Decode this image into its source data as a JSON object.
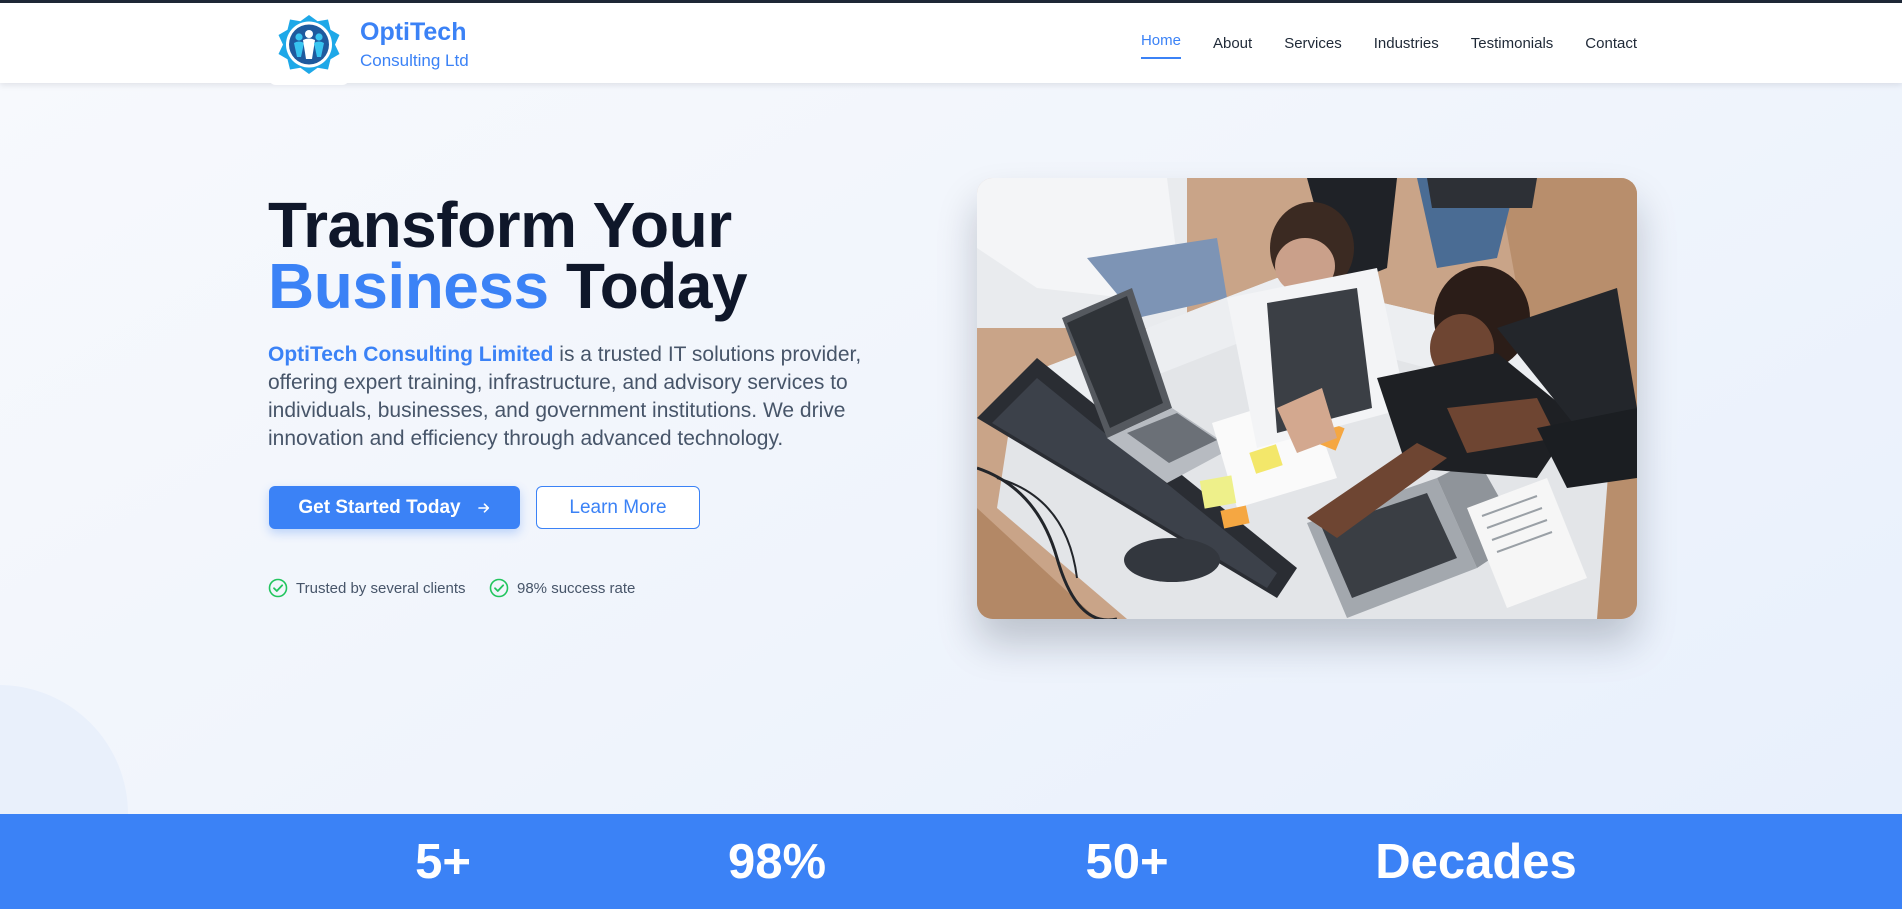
{
  "brand": {
    "name": "OptiTech",
    "subtitle": "Consulting Ltd"
  },
  "nav": {
    "items": [
      {
        "label": "Home",
        "active": true
      },
      {
        "label": "About"
      },
      {
        "label": "Services"
      },
      {
        "label": "Industries"
      },
      {
        "label": "Testimonials"
      },
      {
        "label": "Contact"
      }
    ]
  },
  "hero": {
    "headline_line1": "Transform Your",
    "headline_accent": "Business",
    "headline_rest": " Today",
    "lead_strong": "OptiTech Consulting Limited",
    "lead_rest": " is a trusted IT solutions provider, offering expert training, infrastructure, and advisory services to individuals, businesses, and government institutions. We drive innovation and efficiency through advanced technology.",
    "primary_button": "Get Started Today",
    "primary_button_icon": "arrow-right-icon",
    "secondary_button": "Learn More",
    "trust_items": [
      {
        "label": "Trusted by several clients",
        "icon": "check-circle-icon"
      },
      {
        "label": "98% success rate",
        "icon": "check-circle-icon"
      }
    ],
    "image_icon": "team-meeting-photo"
  },
  "stats": {
    "values": [
      "5+",
      "98%",
      "50+",
      "Decades"
    ]
  },
  "colors": {
    "accent": "#3b82f6",
    "heading": "#0f172a",
    "body_text": "#475569",
    "success": "#22c55e",
    "stats_band": "#3b82f6"
  }
}
